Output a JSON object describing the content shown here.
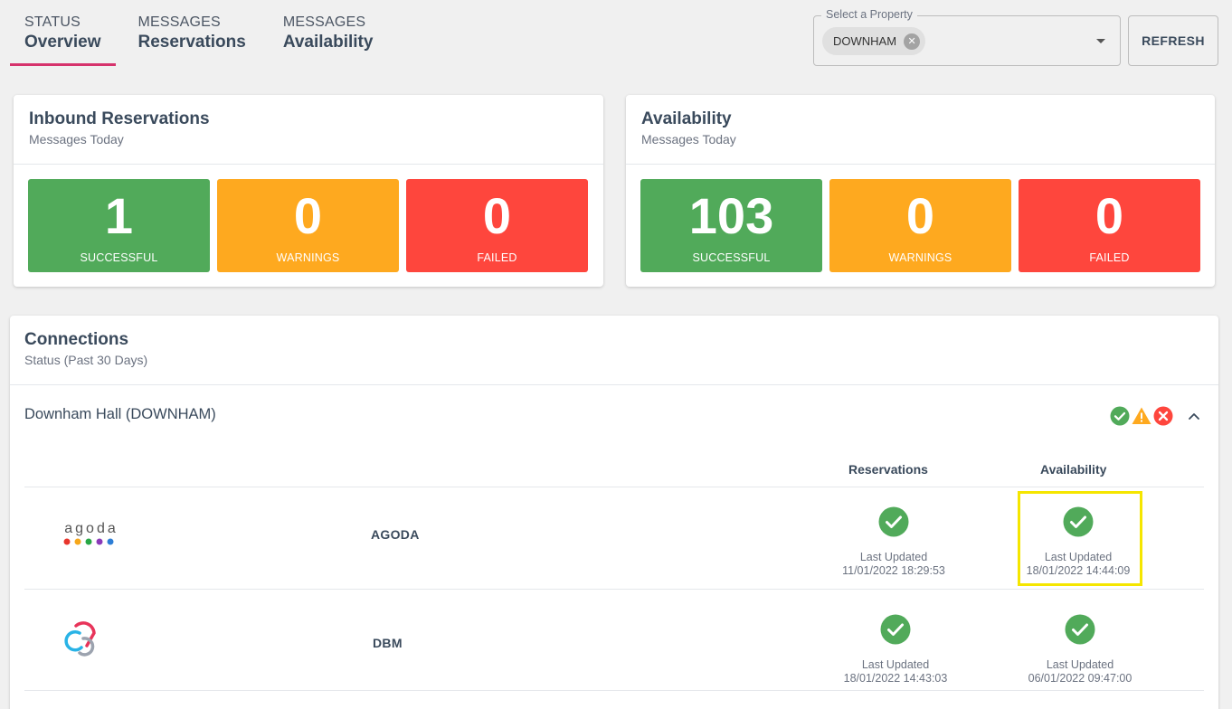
{
  "tabs": [
    {
      "line1": "STATUS",
      "line2": "Overview",
      "active": true
    },
    {
      "line1": "MESSAGES",
      "line2": "Reservations",
      "active": false
    },
    {
      "line1": "MESSAGES",
      "line2": "Availability",
      "active": false
    }
  ],
  "property_select": {
    "legend": "Select a Property",
    "chip_label": "DOWNHAM"
  },
  "refresh_label": "REFRESH",
  "reservations_card": {
    "title": "Inbound Reservations",
    "subtitle": "Messages Today",
    "stats": [
      {
        "value": "1",
        "label": "SUCCESSFUL"
      },
      {
        "value": "0",
        "label": "WARNINGS"
      },
      {
        "value": "0",
        "label": "FAILED"
      }
    ]
  },
  "availability_card": {
    "title": "Availability",
    "subtitle": "Messages Today",
    "stats": [
      {
        "value": "103",
        "label": "SUCCESSFUL"
      },
      {
        "value": "0",
        "label": "WARNINGS"
      },
      {
        "value": "0",
        "label": "FAILED"
      }
    ]
  },
  "connections": {
    "title": "Connections",
    "subtitle": "Status (Past 30 Days)",
    "property_name": "Downham Hall (DOWNHAM)",
    "col_reservations": "Reservations",
    "col_availability": "Availability",
    "channels": [
      {
        "name": "AGODA",
        "logo_text": "agoda",
        "reservations": {
          "status": "ok",
          "label": "Last Updated",
          "time": "11/01/2022 18:29:53"
        },
        "availability": {
          "status": "ok",
          "label": "Last Updated",
          "time": "18/01/2022 14:44:09"
        }
      },
      {
        "name": "DBM",
        "reservations": {
          "status": "ok",
          "label": "Last Updated",
          "time": "18/01/2022 14:43:03"
        },
        "availability": {
          "status": "ok",
          "label": "Last Updated",
          "time": "06/01/2022 09:47:00"
        }
      }
    ]
  },
  "colors": {
    "success": "#51aa5a",
    "warning": "#fea91f",
    "failed": "#fe463d",
    "accent": "#d6336c",
    "highlight": "#f5e600"
  }
}
